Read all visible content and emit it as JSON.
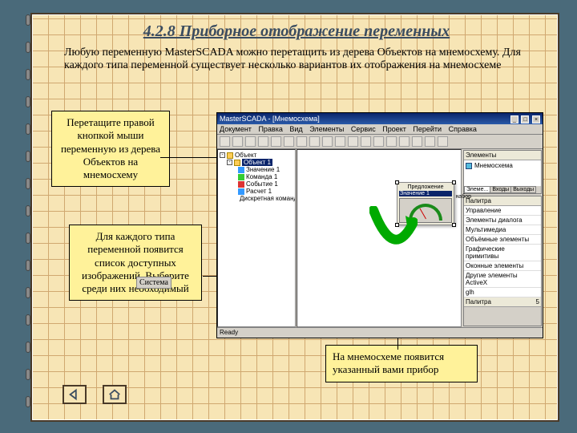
{
  "slide": {
    "title": "4.2.8 Приборное отображение переменных",
    "intro": "Любую переменную MasterSCADA можно перетащить из дерева Объектов на мнемосхему. Для каждого типа переменной существует несколько вариантов их отображения на мнемосхеме"
  },
  "callouts": {
    "c1": "Перетащите правой кнопкой мыши переменную из дерева Объектов на мнемосхему",
    "c2": "Для каждого типа переменной появится список доступных изображений. Выберите среди них необходимый",
    "c3": "На мнемосхеме появится указанный вами прибор"
  },
  "app": {
    "title": "MasterSCADA - [Мнемосхема]",
    "menu": [
      "Документ",
      "Правка",
      "Вид",
      "Элементы",
      "Сервис",
      "Проект",
      "Перейти",
      "Справка"
    ],
    "tree_root": "Объект",
    "tree": {
      "obj": "Объект 1",
      "items": [
        "Значение 1",
        "Команда 1",
        "Событие 1",
        "Расчет 1",
        "Дискретная команда"
      ]
    },
    "right": {
      "elements_hdr": "Элементы",
      "elements_item": "Мнемосхема",
      "tabs": [
        "Элеме...",
        "Входы",
        "Выходы"
      ],
      "palette_hdr": "Палитра",
      "palette": [
        "Управление",
        "Элементы диалога",
        "Мультимедиа",
        "Объёмные элементы",
        "Графические примитивы",
        "Оконные элементы",
        "Другие элементы ActiveX",
        "glh"
      ],
      "pal_footer_l": "Палитра",
      "pal_footer_r": "5"
    },
    "status": "Ready",
    "popup": {
      "top": "Предложение",
      "sel": "Значение 1",
      "side": "набор"
    }
  },
  "extras": {
    "system_label": "Система"
  },
  "nav": {
    "prev": "◁",
    "home": "⌂"
  }
}
